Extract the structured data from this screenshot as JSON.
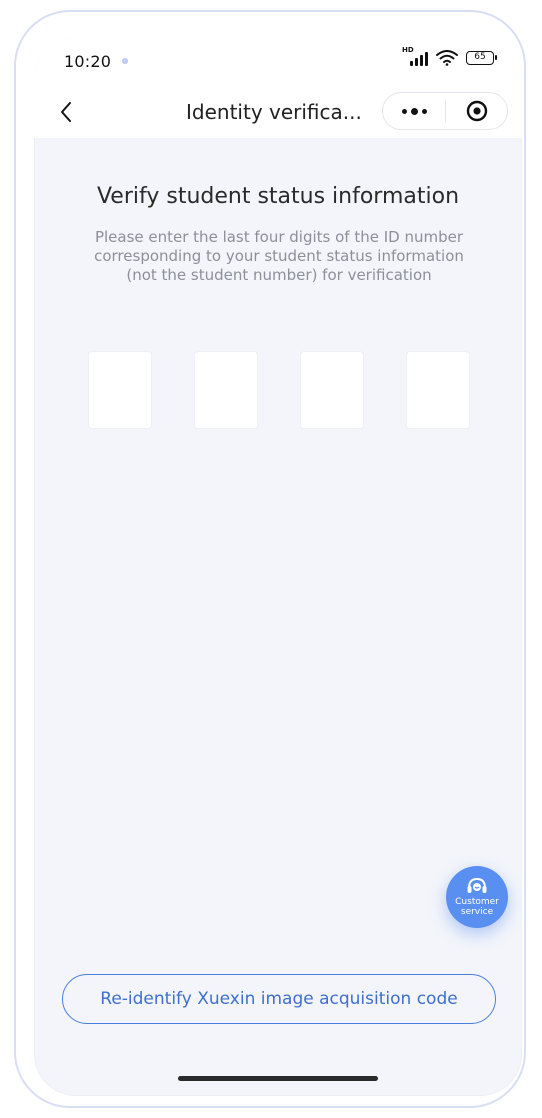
{
  "status_bar": {
    "time": "10:20",
    "signal_label": "HD",
    "battery": "65"
  },
  "nav": {
    "title": "Identity verifica..."
  },
  "content": {
    "heading": "Verify student status information",
    "instruction": "Please enter the last four digits of the ID number corresponding to your student status information (not the student number) for verification",
    "digits": [
      "",
      "",
      "",
      ""
    ]
  },
  "customer_service": {
    "label_line1": "Customer",
    "label_line2": "service"
  },
  "actions": {
    "reidentify_label": "Re-identify Xuexin image acquisition code"
  },
  "colors": {
    "accent": "#4a7fe0",
    "cs_button": "#5a8ff2",
    "background": "#f3f5fa"
  }
}
